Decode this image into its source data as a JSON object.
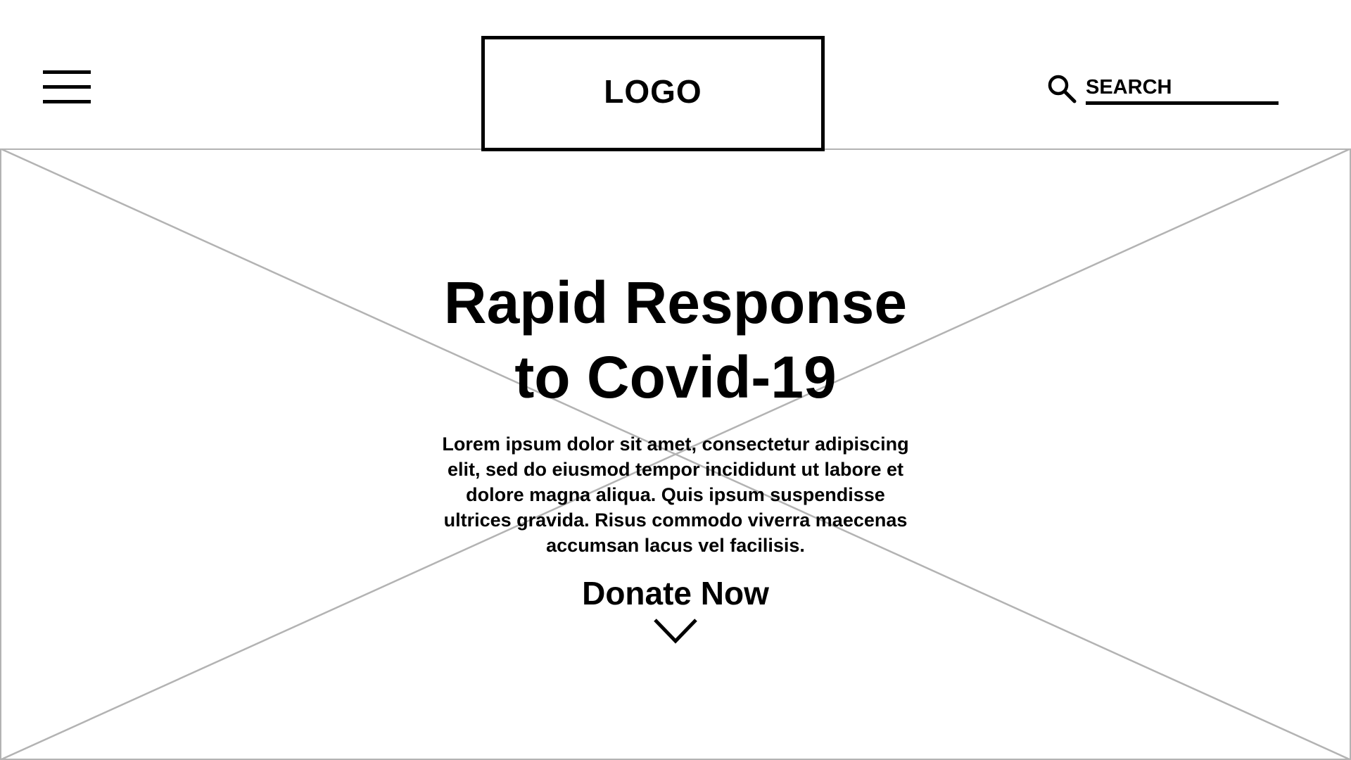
{
  "header": {
    "menu_icon": "hamburger-menu-icon",
    "logo_text": "LOGO",
    "search": {
      "icon": "search-icon",
      "placeholder": "SEARCH"
    }
  },
  "hero": {
    "image_placeholder": "crossed-box-image-placeholder",
    "title_line1": "Rapid Response",
    "title_line2": "to Covid-19",
    "body": "Lorem ipsum dolor sit amet, consectetur adipiscing elit, sed do eiusmod tempor incididunt ut labore et dolore magna aliqua. Quis ipsum suspendisse ultrices gravida. Risus commodo viverra maecenas accumsan lacus vel facilisis.",
    "cta_label": "Donate Now",
    "cta_icon": "chevron-down-icon"
  },
  "colors": {
    "ink": "#000000",
    "placeholder_line": "#b3b3b3",
    "background": "#ffffff"
  }
}
